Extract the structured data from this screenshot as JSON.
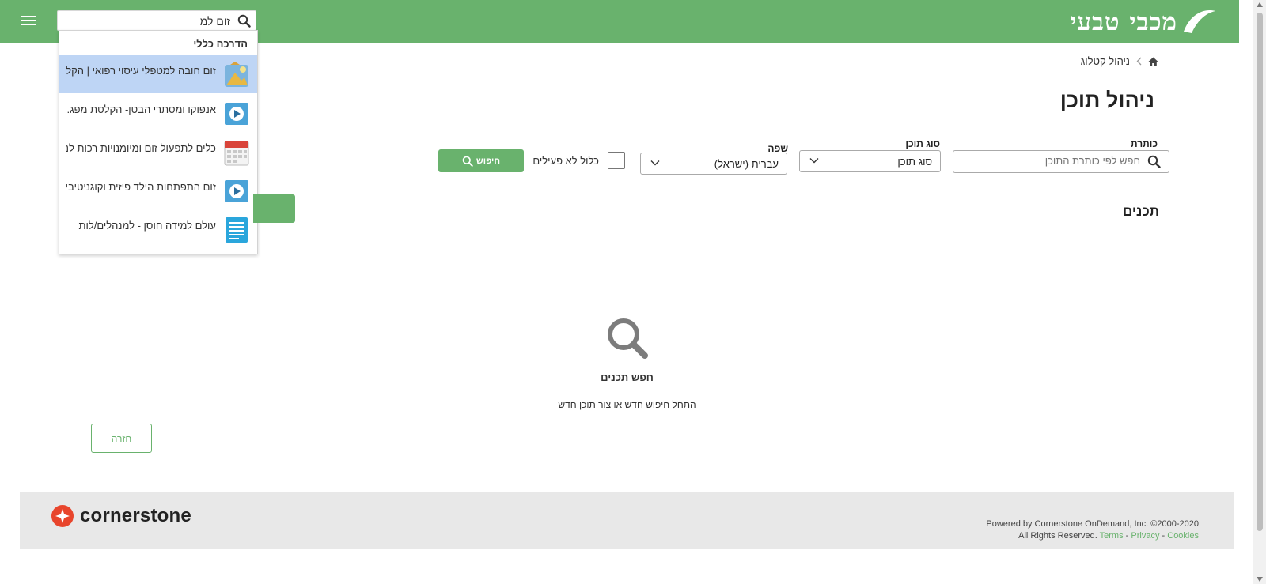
{
  "header": {
    "logo_text": "מכבי טבעי",
    "menu_icon": "hamburger-icon",
    "search": {
      "value": "זום למ",
      "icon": "search-icon"
    },
    "brand_color": "#69b26d"
  },
  "autocomplete": {
    "heading": "הדרכה כללי",
    "items": [
      {
        "label": "זום חובה למטפלי עיסוי רפואי | הקל...",
        "icon": "course-image-icon",
        "selected": true
      },
      {
        "label": "אנפוקו ומסתרי הבטן- הקלטת מפג...",
        "icon": "video-play-icon"
      },
      {
        "label": "כלים לתפעול זום ומיומנויות רכות לני...",
        "icon": "calendar-icon"
      },
      {
        "label": "זום התפתחות הילד פיזית וקוגניטיבי...",
        "icon": "video-play-icon"
      },
      {
        "label": "עולם למידה חוסן - למנהלים/לות",
        "icon": "document-icon"
      }
    ]
  },
  "breadcrumb": {
    "home_icon": "home-icon",
    "current": "ניהול קטלוג"
  },
  "page": {
    "title": "ניהול תוכן"
  },
  "filters": {
    "title_label": "כותרת",
    "title_placeholder": "חפש לפי כותרת התוכן",
    "type_label": "סוג תוכן",
    "type_value": "סוג תוכן",
    "language_label": "שפה",
    "language_value": "עברית (ישראל)",
    "include_inactive_label": "כלול לא פעילים",
    "include_inactive_checked": false,
    "search_button": "חיפוש"
  },
  "content": {
    "section_title": "תכנים",
    "empty_title": "חפש תכנים",
    "empty_subtitle": "התחל חיפוש חדש או צור תוכן חדש"
  },
  "back_button": "חזרה",
  "footer": {
    "brand": "cornerstone",
    "powered_by": "Powered by Cornerstone OnDemand, Inc. ©2000-2020",
    "rights": "All Rights Reserved.",
    "terms": "Terms",
    "privacy": "Privacy",
    "cookies": "Cookies",
    "separator": "-"
  }
}
